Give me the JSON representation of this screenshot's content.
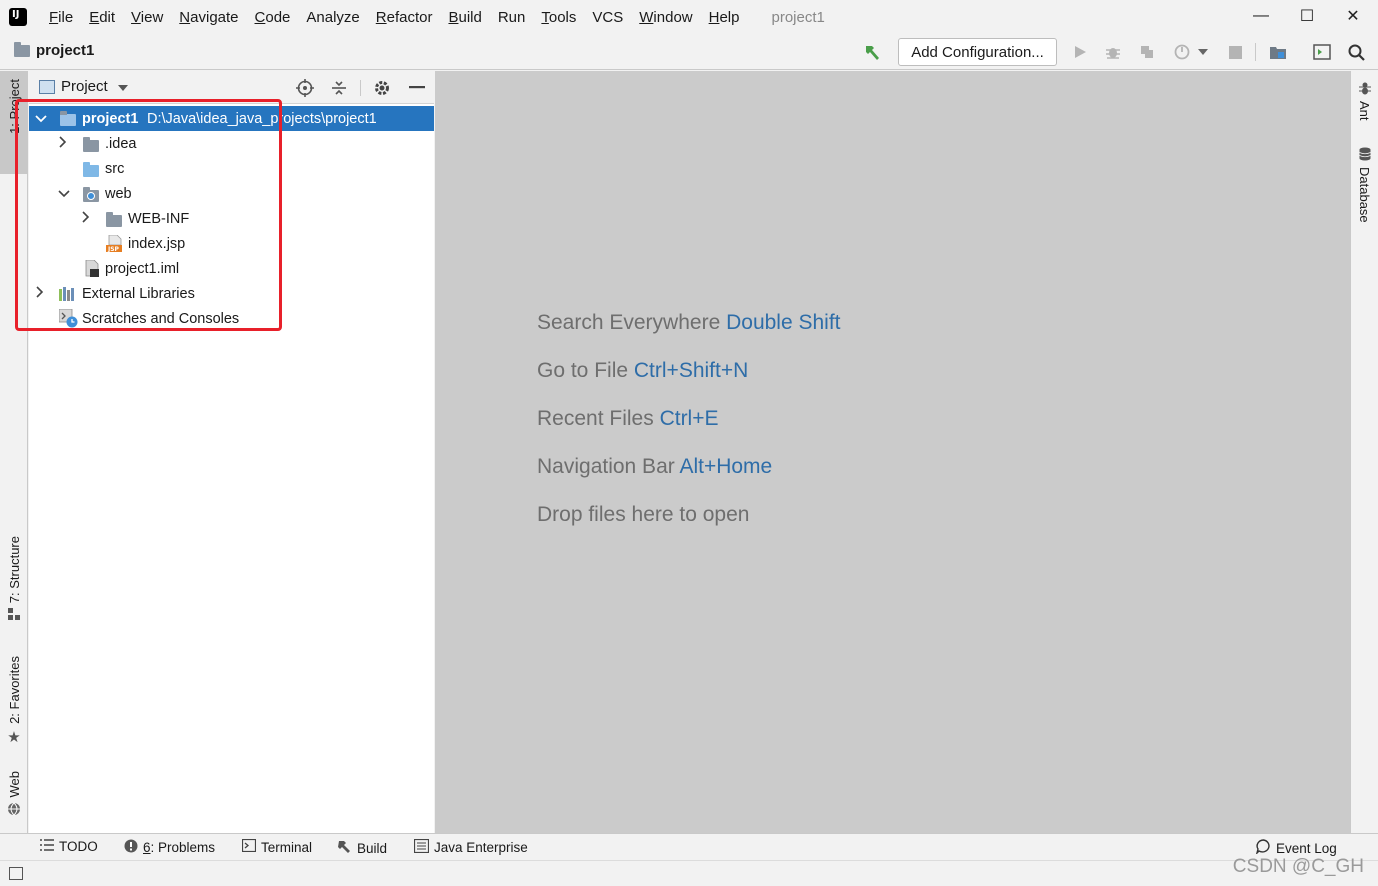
{
  "window": {
    "title": "project1",
    "app_icon": "intellij-idea-icon",
    "controls": {
      "minimize": "—",
      "maximize": "☐",
      "close": "✕"
    }
  },
  "menu": [
    {
      "label": "File",
      "mnemonic": "F",
      "rest": "ile"
    },
    {
      "label": "Edit",
      "mnemonic": "E",
      "rest": "dit"
    },
    {
      "label": "View",
      "mnemonic": "V",
      "rest": "iew"
    },
    {
      "label": "Navigate",
      "mnemonic": "N",
      "rest": "avigate"
    },
    {
      "label": "Code",
      "mnemonic": "C",
      "rest": "ode"
    },
    {
      "label": "Analyze",
      "mnemonic": "",
      "rest": "Analyze"
    },
    {
      "label": "Refactor",
      "mnemonic": "R",
      "rest": "efactor"
    },
    {
      "label": "Build",
      "mnemonic": "B",
      "rest": "uild"
    },
    {
      "label": "Run",
      "mnemonic": "",
      "rest": "Run"
    },
    {
      "label": "Tools",
      "mnemonic": "T",
      "rest": "ools"
    },
    {
      "label": "VCS",
      "mnemonic": "",
      "rest": "VCS"
    },
    {
      "label": "Window",
      "mnemonic": "W",
      "rest": "indow"
    },
    {
      "label": "Help",
      "mnemonic": "H",
      "rest": "elp"
    }
  ],
  "navbar": {
    "project_name": "project1",
    "add_configuration": "Add Configuration..."
  },
  "left_stripe": {
    "project_tab": "1: Project",
    "structure_tab": "7: Structure",
    "favorites_tab": "2: Favorites",
    "web_tab": "Web"
  },
  "right_stripe": {
    "ant_tab": "Ant",
    "database_tab": "Database"
  },
  "project_panel": {
    "title": "Project",
    "tree": [
      {
        "label": "project1",
        "path": "D:\\Java\\idea_java_projects\\project1",
        "icon": "module-folder-icon"
      },
      {
        "label": ".idea",
        "icon": "folder-icon"
      },
      {
        "label": "src",
        "icon": "source-folder-icon"
      },
      {
        "label": "web",
        "icon": "web-folder-icon"
      },
      {
        "label": "WEB-INF",
        "icon": "folder-icon"
      },
      {
        "label": "index.jsp",
        "icon": "jsp-file-icon"
      },
      {
        "label": "project1.iml",
        "icon": "iml-file-icon"
      },
      {
        "label": "External Libraries",
        "icon": "libraries-icon"
      },
      {
        "label": "Scratches and Consoles",
        "icon": "scratches-icon"
      }
    ]
  },
  "editor_hints": [
    {
      "text": "Search Everywhere",
      "key": "Double Shift"
    },
    {
      "text": "Go to File",
      "key": "Ctrl+Shift+N"
    },
    {
      "text": "Recent Files",
      "key": "Ctrl+E"
    },
    {
      "text": "Navigation Bar",
      "key": "Alt+Home"
    },
    {
      "text": "Drop files here to open",
      "key": ""
    }
  ],
  "bottom_tabs": {
    "todo": "TODO",
    "problems_num": "6",
    "problems": ": Problems",
    "terminal": "Terminal",
    "build": "Build",
    "java_enterprise": "Java Enterprise",
    "event_log": "Event Log"
  },
  "watermark": "CSDN @C_GH",
  "colors": {
    "selection": "#2675bf",
    "highlight_box": "#e8202a",
    "hint_key": "#2e6da8",
    "editor_bg": "#cbcbcb"
  }
}
